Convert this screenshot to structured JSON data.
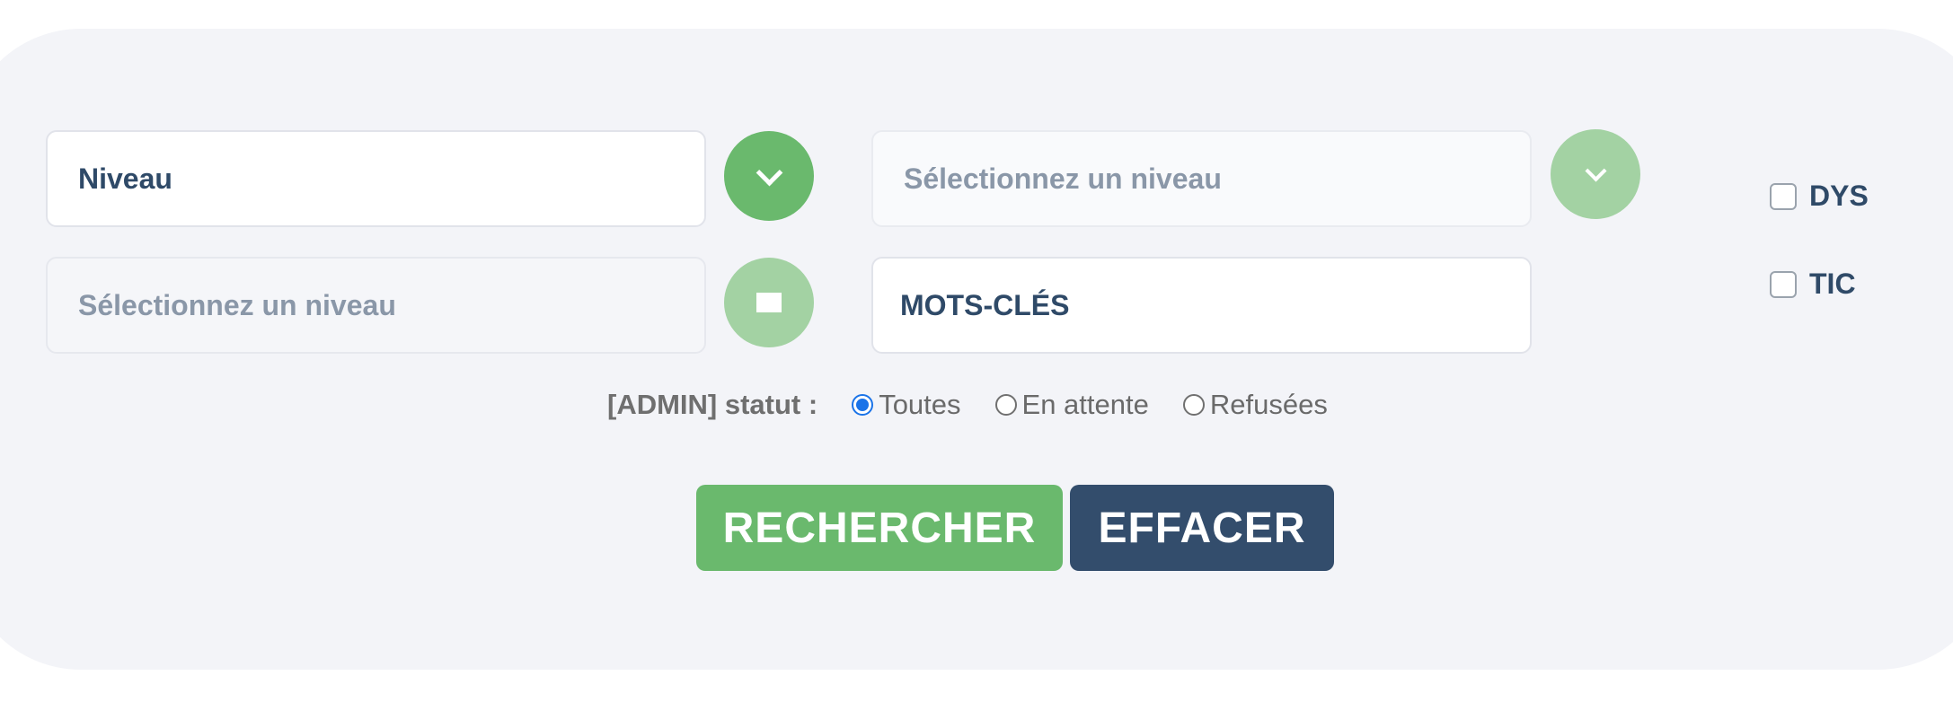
{
  "filters": {
    "niveau_field": {
      "value": "Niveau"
    },
    "niveau_select_top": {
      "placeholder": "Sélectionnez un niveau"
    },
    "niveau_select_bottom": {
      "placeholder": "Sélectionnez un niveau"
    },
    "keywords_field": {
      "value": "MOTS-CLÉS"
    }
  },
  "checkboxes": [
    {
      "label": "DYS",
      "checked": false
    },
    {
      "label": "TIC",
      "checked": false
    }
  ],
  "status": {
    "label": "[ADMIN] statut :",
    "options": [
      {
        "label": "Toutes",
        "selected": true
      },
      {
        "label": "En attente",
        "selected": false
      },
      {
        "label": "Refusées",
        "selected": false
      }
    ]
  },
  "actions": {
    "search_label": "RECHERCHER",
    "clear_label": "EFFACER"
  },
  "colors": {
    "accent_green": "#6ab96d",
    "accent_green_light": "#a3d2a3",
    "navy": "#334d6c",
    "panel_bg": "#f3f4f8"
  },
  "icons": {
    "dropdown_active": "chevron-down-icon",
    "dropdown_inactive": "chevron-down-icon",
    "stop": "square-icon"
  }
}
